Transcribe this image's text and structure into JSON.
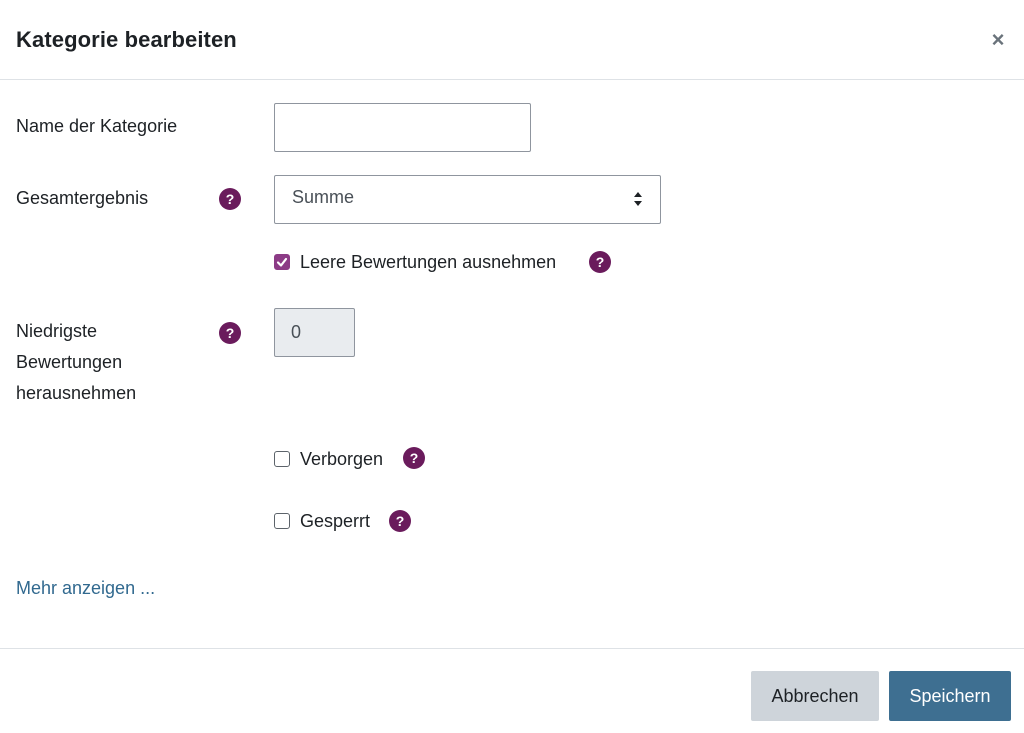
{
  "header": {
    "title": "Kategorie bearbeiten",
    "close_symbol": "×"
  },
  "form": {
    "name_label": "Name der Kategorie",
    "name_value": "",
    "aggregation_label": "Gesamtergebnis",
    "aggregation_value": "Summe",
    "exclude_empty_label": "Leere Bewertungen ausnehmen",
    "exclude_empty_checked": true,
    "drop_lowest_label_line1": "Niedrigste",
    "drop_lowest_label_line2": "Bewertungen",
    "drop_lowest_label_line3": "herausnehmen",
    "drop_lowest_value": "0",
    "hidden_label": "Verborgen",
    "hidden_checked": false,
    "locked_label": "Gesperrt",
    "locked_checked": false,
    "help_symbol": "?"
  },
  "more_link": "Mehr anzeigen ...",
  "footer": {
    "cancel_label": "Abbrechen",
    "save_label": "Speichern"
  },
  "colors": {
    "accent": "#8c3b86",
    "help_icon": "#6a1b5c",
    "primary_button": "#3e6f91",
    "secondary_button": "#ced4da",
    "link": "#31698f"
  },
  "icons": {
    "close": "close-icon",
    "help": "help-icon",
    "select_arrow": "sort-arrows-icon",
    "check": "checkmark-icon"
  }
}
